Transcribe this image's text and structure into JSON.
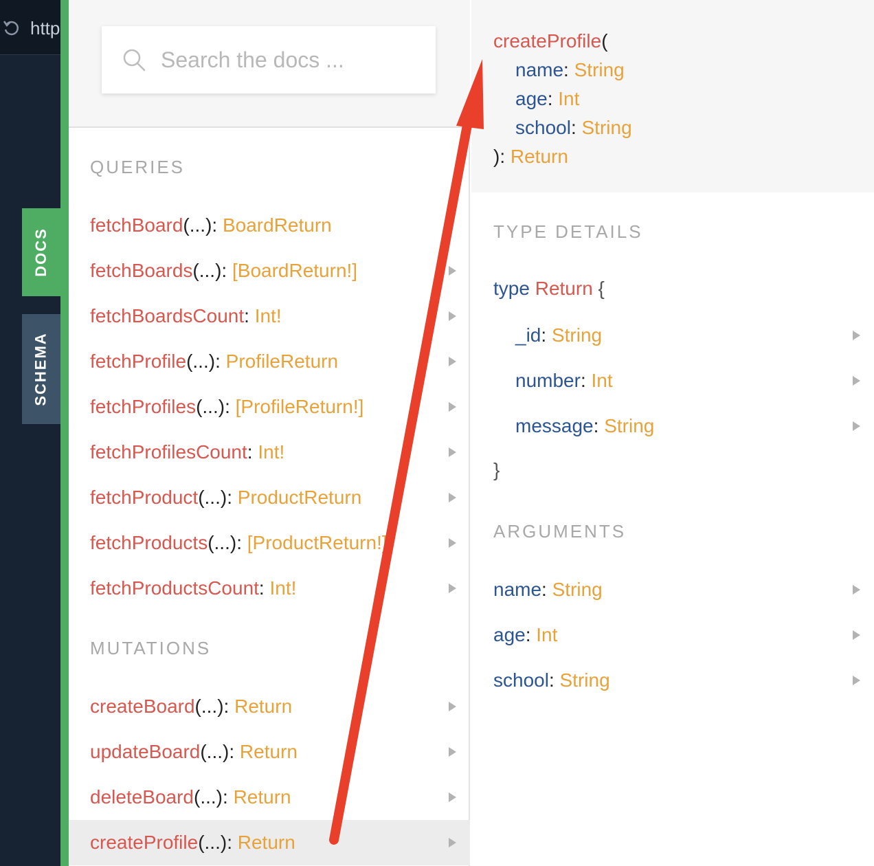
{
  "editor": {
    "url_text": "http"
  },
  "tabs": {
    "docs": "DOCS",
    "schema": "SCHEMA"
  },
  "search": {
    "placeholder": "Search the docs ..."
  },
  "queries": {
    "title": "QUERIES",
    "items": [
      {
        "name": "fetchBoard",
        "args": "(...)",
        "sep": ": ",
        "type": "BoardReturn"
      },
      {
        "name": "fetchBoards",
        "args": "(...)",
        "sep": ": ",
        "type": "[BoardReturn!]"
      },
      {
        "name": "fetchBoardsCount",
        "args": "",
        "sep": ": ",
        "type": "Int!"
      },
      {
        "name": "fetchProfile",
        "args": "(...)",
        "sep": ": ",
        "type": "ProfileReturn"
      },
      {
        "name": "fetchProfiles",
        "args": "(...)",
        "sep": ": ",
        "type": "[ProfileReturn!]"
      },
      {
        "name": "fetchProfilesCount",
        "args": "",
        "sep": ": ",
        "type": "Int!"
      },
      {
        "name": "fetchProduct",
        "args": "(...)",
        "sep": ": ",
        "type": "ProductReturn"
      },
      {
        "name": "fetchProducts",
        "args": "(...)",
        "sep": ": ",
        "type": "[ProductReturn!]"
      },
      {
        "name": "fetchProductsCount",
        "args": "",
        "sep": ": ",
        "type": "Int!"
      }
    ]
  },
  "mutations": {
    "title": "MUTATIONS",
    "items": [
      {
        "name": "createBoard",
        "args": "(...)",
        "sep": ": ",
        "type": "Return"
      },
      {
        "name": "updateBoard",
        "args": "(...)",
        "sep": ": ",
        "type": "Return"
      },
      {
        "name": "deleteBoard",
        "args": "(...)",
        "sep": ": ",
        "type": "Return"
      },
      {
        "name": "createProfile",
        "args": "(...)",
        "sep": ": ",
        "type": "Return"
      }
    ]
  },
  "detail": {
    "signature": {
      "fn": "createProfile",
      "open": "(",
      "args": [
        {
          "name": "name",
          "sep": ": ",
          "type": "String"
        },
        {
          "name": "age",
          "sep": ": ",
          "type": "Int"
        },
        {
          "name": "school",
          "sep": ": ",
          "type": "String"
        }
      ],
      "close": "): ",
      "return_type": "Return"
    },
    "type_details": {
      "title": "TYPE DETAILS",
      "keyword": "type",
      "type_name": "Return",
      "open_brace": "{",
      "close_brace": "}",
      "fields": [
        {
          "name": "_id",
          "sep": ": ",
          "type": "String"
        },
        {
          "name": "number",
          "sep": ": ",
          "type": "Int"
        },
        {
          "name": "message",
          "sep": ": ",
          "type": "String"
        }
      ]
    },
    "arguments": {
      "title": "ARGUMENTS",
      "items": [
        {
          "name": "name",
          "sep": ": ",
          "type": "String"
        },
        {
          "name": "age",
          "sep": ": ",
          "type": "Int"
        },
        {
          "name": "school",
          "sep": ": ",
          "type": "String"
        }
      ]
    }
  },
  "colors": {
    "function_name": "#d6584f",
    "type": "#e8a23a",
    "argument": "#2c5592",
    "docs_tab": "#4ead62",
    "schema_tab": "#3d5468",
    "annotation_arrow": "#e8402a"
  }
}
